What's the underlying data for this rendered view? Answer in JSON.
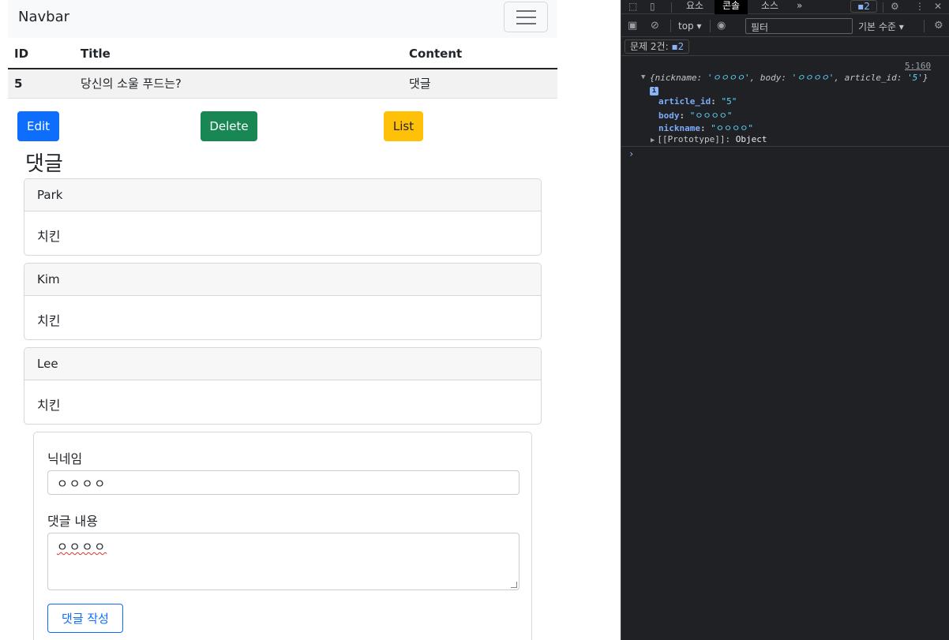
{
  "navbar": {
    "brand": "Navbar"
  },
  "table": {
    "headers": [
      "ID",
      "Title",
      "Content"
    ],
    "row": {
      "id": "5",
      "title": "당신의 소울 푸드는?",
      "content": "댓글"
    }
  },
  "buttons": {
    "edit": "Edit",
    "delete": "Delete",
    "list": "List"
  },
  "comments_title": "댓글",
  "comments": [
    {
      "nickname": "Park",
      "body": "치킨"
    },
    {
      "nickname": "Kim",
      "body": "치킨"
    },
    {
      "nickname": "Lee",
      "body": "치킨"
    }
  ],
  "form": {
    "nickname_label": "닉네임",
    "nickname_value": "ㅇㅇㅇㅇ",
    "body_label": "댓글 내용",
    "body_value": "ㅇㅇㅇㅇ",
    "submit_label": "댓글 작성"
  },
  "devtools": {
    "tabs": [
      "요소",
      "콘솔",
      "소스",
      "»"
    ],
    "active_tab": "콘솔",
    "issues_badge": "2",
    "context": "top",
    "filter_placeholder": "필터",
    "levels": "기본 수준",
    "issues_label": "문제 2건:",
    "issues_count": "2",
    "log_source": "5:160",
    "log_summary": {
      "open": "{",
      "k1": "nickname",
      "v1": "'ㅇㅇㅇㅇ'",
      "k2": "body",
      "v2": "'ㅇㅇㅇㅇ'",
      "k3": "article_id",
      "v3": "'5'",
      "close": "}"
    },
    "props": [
      {
        "key": "article_id",
        "value": "\"5\""
      },
      {
        "key": "body",
        "value": "\"ㅇㅇㅇㅇ\""
      },
      {
        "key": "nickname",
        "value": "\"ㅇㅇㅇㅇ\""
      }
    ],
    "proto_label": "[[Prototype]]",
    "proto_value": "Object",
    "prompt": "›"
  }
}
